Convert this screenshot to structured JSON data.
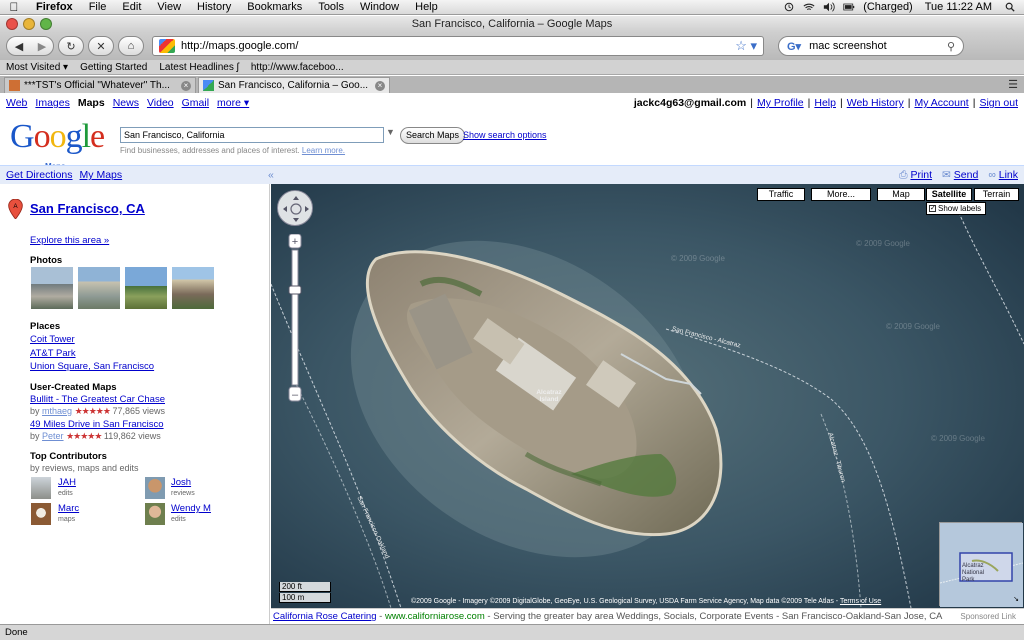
{
  "os_menubar": {
    "app_name": "Firefox",
    "items": [
      "File",
      "Edit",
      "View",
      "History",
      "Bookmarks",
      "Tools",
      "Window",
      "Help"
    ],
    "battery": "(Charged)",
    "clock": "Tue 11:22 AM"
  },
  "window": {
    "title": "San Francisco, California – Google Maps"
  },
  "toolbar": {
    "url": "http://maps.google.com/",
    "search_value": "mac screenshot"
  },
  "bookmarks": [
    "Most Visited ▾",
    "Getting Started",
    "Latest Headlines ʃ",
    "http://www.faceboo..."
  ],
  "tabs": [
    {
      "title": "***TST's Official \"Whatever\" Th...",
      "active": false
    },
    {
      "title": "San Francisco, California – Goo...",
      "active": true
    }
  ],
  "gnav": {
    "links": [
      "Web",
      "Images",
      "Maps",
      "News",
      "Video",
      "Gmail",
      "more ▾"
    ],
    "current": "Maps",
    "email": "jackc4g63@gmail.com",
    "account_links": [
      "My Profile",
      "Help",
      "Web History",
      "My Account",
      "Sign out"
    ]
  },
  "header": {
    "logo_sub": "Maps",
    "search_value": "San Francisco, California",
    "search_button": "Search Maps",
    "search_options": "Show search options",
    "hint": "Find businesses, addresses and places of interest.",
    "hint_link": "Learn more."
  },
  "strip": {
    "left_links": [
      "Get Directions",
      "My Maps"
    ],
    "collapse": "«",
    "right_links": [
      "Print",
      "Send",
      "Link"
    ]
  },
  "sidebar": {
    "place_title": "San Francisco, CA",
    "explore": "Explore this area »",
    "photos_heading": "Photos",
    "places_heading": "Places",
    "places": [
      "Coit Tower",
      "AT&T Park",
      "Union Square, San Francisco"
    ],
    "user_maps_heading": "User-Created Maps",
    "user_maps": [
      {
        "title": "Bullitt - The Greatest Car Chase",
        "by": "by",
        "author": "mthaeg",
        "stars": "★★★★★",
        "views": "77,865 views"
      },
      {
        "title": "49 Miles Drive in San Francisco",
        "by": "by",
        "author": "Peter",
        "stars": "★★★★★",
        "views": "119,862 views"
      }
    ],
    "contributors_heading": "Top Contributors",
    "contributors_sub": "by reviews, maps and edits",
    "contributors": [
      {
        "name": "JAH",
        "role": "edits"
      },
      {
        "name": "Josh",
        "role": "reviews"
      },
      {
        "name": "Marc",
        "role": "maps"
      },
      {
        "name": "Wendy M",
        "role": "edits"
      }
    ]
  },
  "map": {
    "types": [
      "Traffic",
      "More...",
      "Map",
      "Satellite",
      "Terrain"
    ],
    "selected_type": "Satellite",
    "show_labels": "Show labels",
    "island_label": "Alcatraz Island",
    "route_label": "San Francisco - Alcatraz",
    "route_label2": "San Francisco-Oakland",
    "route_label3": "Alcatraz - Tiburon",
    "watermark": "© 2009 Google",
    "overview_label": "Alcatraz National Park",
    "scale_ft": "200 ft",
    "scale_m": "100 m",
    "copyright": "©2009 Google - Imagery ©2009 DigitalGlobe, GeoEye, U.S. Geological Survey, USDA Farm Service Agency, Map data ©2009 Tele Atlas - ",
    "terms": "Terms of Use"
  },
  "ad": {
    "title": "California Rose Catering",
    "url": "www.californiarose.com",
    "text": "Serving the greater bay area Weddings, Socials, Corporate Events - San Francisco-Oakland-San Jose, CA",
    "sponsored": "Sponsored Link"
  },
  "status": "Done"
}
